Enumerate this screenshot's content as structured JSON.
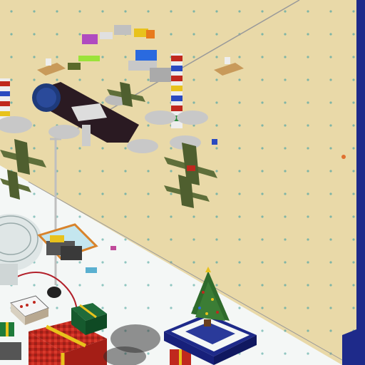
{
  "scene": {
    "kind": "isometric voxel build world",
    "colors": {
      "sand": "#e9d9a8",
      "sand_dot": "#7fb5a6",
      "snow": "#f4f7f6",
      "snow_dot": "#8fc6c0",
      "wall": "#1e2a8a",
      "tree_green": "#2f6b2c",
      "gift_red": "#c0281e",
      "gift_yellow": "#e8c21c",
      "plane_olive": "#5f6f3a",
      "airship_dark": "#2a1a22"
    },
    "icons": [
      "christmas-tree-icon",
      "gift-box-icon",
      "cake-icon",
      "airplane-icon",
      "airship-icon",
      "flag-tower-icon",
      "lamp-post-icon",
      "banner-icon"
    ]
  }
}
